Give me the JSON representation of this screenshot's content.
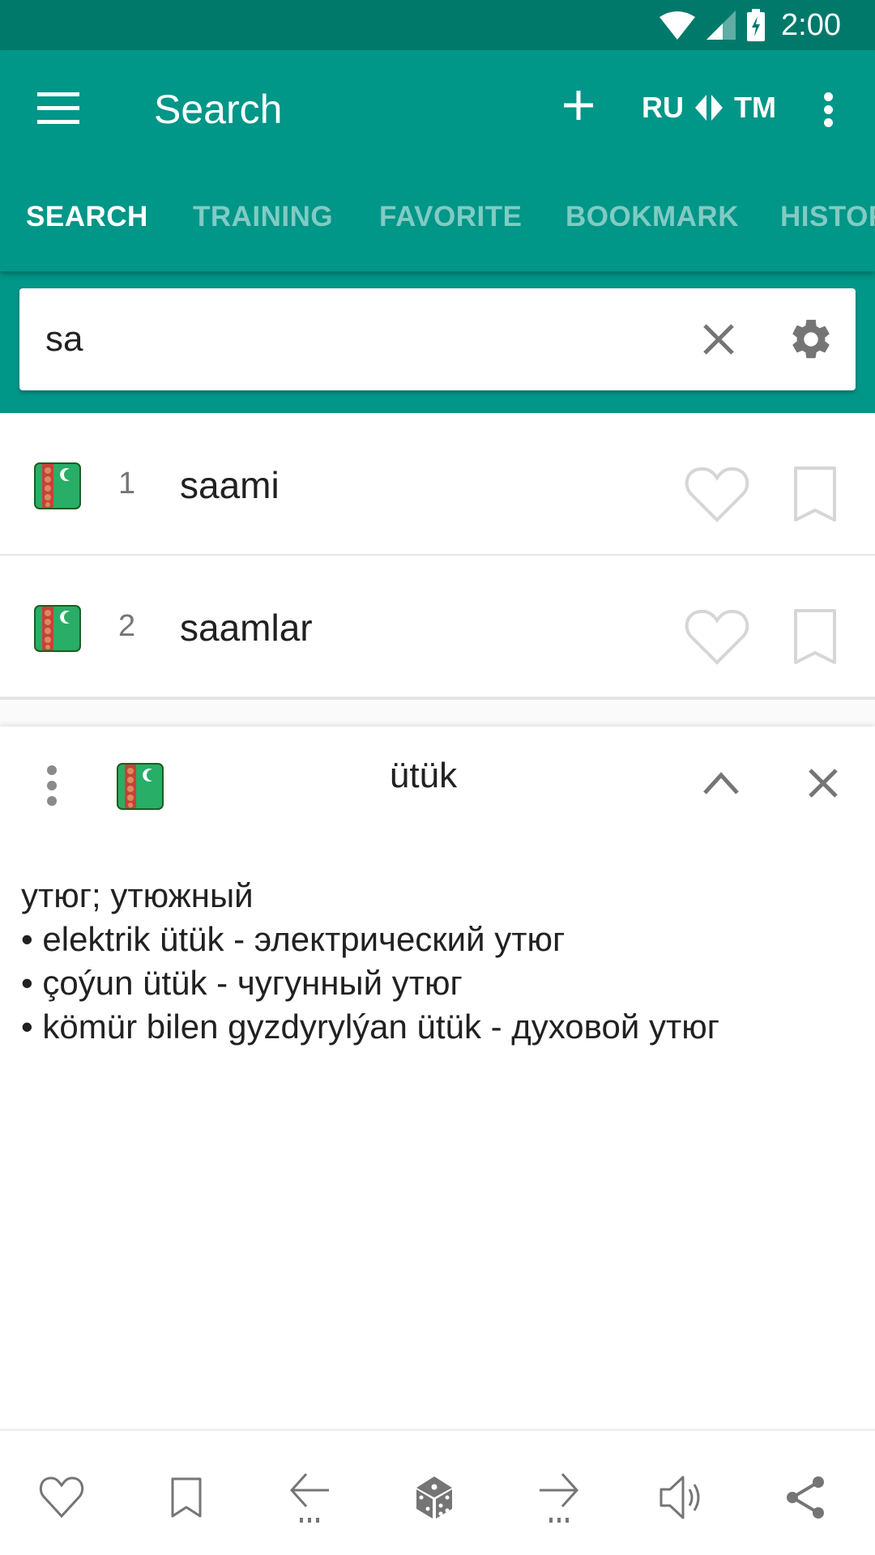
{
  "status_bar": {
    "time": "2:00",
    "icons": [
      "wifi-icon",
      "signal-icon",
      "battery-charging-icon"
    ]
  },
  "app_bar": {
    "title": "Search",
    "add_icon": "plus-icon",
    "language_pair": {
      "from": "RU",
      "to": "TM",
      "swap_icon": "swap-arrows-icon"
    },
    "menu_icon": "hamburger-icon",
    "overflow_icon": "more-vert-icon"
  },
  "tabs": [
    {
      "label": "SEARCH",
      "active": true
    },
    {
      "label": "TRAINING",
      "active": false
    },
    {
      "label": "FAVORITE",
      "active": false
    },
    {
      "label": "BOOKMARK",
      "active": false
    },
    {
      "label": "HISTORY",
      "active": false
    }
  ],
  "search": {
    "value": "sa",
    "placeholder": "",
    "clear_icon": "close-icon",
    "settings_icon": "gear-icon"
  },
  "results": [
    {
      "index": "1",
      "word": "saami",
      "flag": "turkmenistan-flag",
      "favorite": false,
      "bookmarked": false
    },
    {
      "index": "2",
      "word": "saamlar",
      "flag": "turkmenistan-flag",
      "favorite": false,
      "bookmarked": false
    }
  ],
  "detail": {
    "word": "ütük",
    "flag": "turkmenistan-flag",
    "definition_lines": [
      "утюг; утюжный",
      "• elektrik ütük - электрический утюг",
      "• çoýun ütük - чугунный утюг",
      "• kömür bilen gyzdyrylýan ütük - духовой утюг"
    ]
  },
  "bottom_toolbar": [
    {
      "name": "favorite",
      "icon": "heart-outline-icon"
    },
    {
      "name": "bookmark",
      "icon": "bookmark-outline-icon"
    },
    {
      "name": "previous",
      "icon": "arrow-left-icon"
    },
    {
      "name": "random",
      "icon": "dice-icon"
    },
    {
      "name": "next",
      "icon": "arrow-right-icon"
    },
    {
      "name": "speak",
      "icon": "speaker-icon"
    },
    {
      "name": "share",
      "icon": "share-icon"
    }
  ],
  "colors": {
    "primary": "#009688",
    "primary_dark": "#00796b",
    "tab_inactive": "#80cbc4",
    "icon_grey": "#757575",
    "icon_light": "#d6d6d6"
  }
}
